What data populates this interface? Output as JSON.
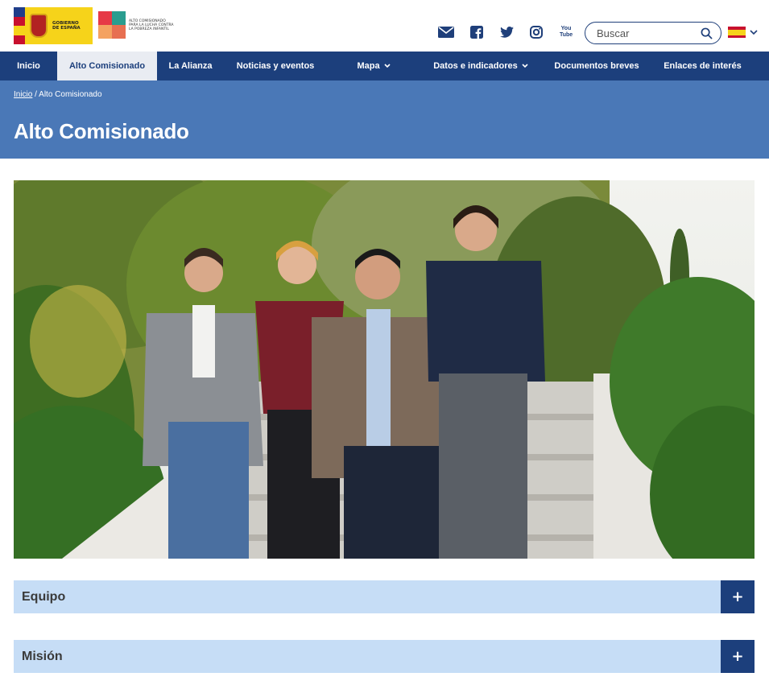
{
  "header": {
    "gov_logo_text": "GOBIERNO DE ESPAÑA",
    "alto_logo_text": "ALTO COMISIONADO PARA LA LUCHA CONTRA LA POBREZA INFANTIL",
    "social_icons": [
      "mail-icon",
      "facebook-icon",
      "twitter-icon",
      "instagram-icon",
      "youtube-icon"
    ],
    "youtube_label": "You Tube",
    "search_placeholder": "Buscar",
    "language": "es"
  },
  "nav": {
    "items": [
      {
        "label": "Inicio"
      },
      {
        "label": "Alto Comisionado"
      },
      {
        "label": "La Alianza"
      },
      {
        "label": "Noticias y eventos"
      },
      {
        "label": "Mapa"
      },
      {
        "label": "Datos e indicadores"
      },
      {
        "label": "Documentos breves"
      },
      {
        "label": "Enlaces de interés"
      }
    ]
  },
  "breadcrumb": {
    "home": "Inicio",
    "separator": "/",
    "current": "Alto Comisionado"
  },
  "page": {
    "title": "Alto Comisionado"
  },
  "accordions": [
    {
      "label": "Equipo",
      "toggle": "+"
    },
    {
      "label": "Misión",
      "toggle": "+"
    }
  ],
  "colors": {
    "navy": "#1c3f7c",
    "banner": "#4a78b7",
    "accordion": "#c6ddf6"
  }
}
